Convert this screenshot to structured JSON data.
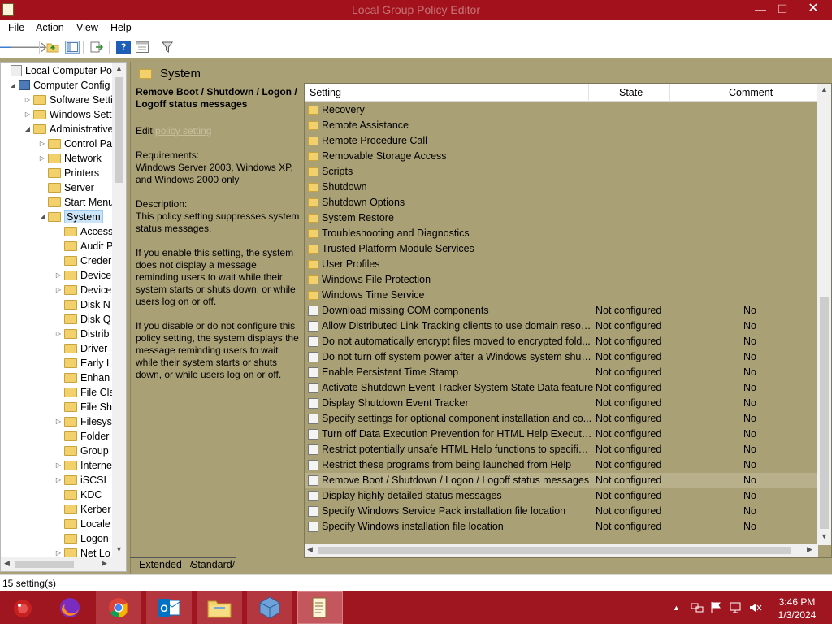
{
  "window": {
    "title": "Local Group Policy Editor",
    "controls": {
      "minimize": "—",
      "maximize": "☐",
      "close": "✕"
    }
  },
  "menu": [
    "File",
    "Action",
    "View",
    "Help"
  ],
  "toolbar": {
    "icons": [
      "back-icon",
      "forward-icon",
      "up-folder-icon",
      "show-hide-tree-icon",
      "export-list-icon",
      "help-icon",
      "view-icon",
      "filter-icon"
    ]
  },
  "tree": {
    "items": [
      {
        "label": "Local Computer Polic",
        "icon": "policy"
      },
      {
        "label": "Computer Config",
        "icon": "computer",
        "expander": "◢"
      },
      {
        "label": "Software Setti",
        "icon": "folder",
        "expander": "▷"
      },
      {
        "label": "Windows Sett",
        "icon": "folder",
        "expander": "▷"
      },
      {
        "label": "Administrative",
        "icon": "folder",
        "expander": "◢"
      },
      {
        "label": "Control Pa",
        "icon": "folder",
        "expander": "▷"
      },
      {
        "label": "Network",
        "icon": "folder",
        "expander": "▷"
      },
      {
        "label": "Printers",
        "icon": "folder",
        "expander": ""
      },
      {
        "label": "Server",
        "icon": "folder",
        "expander": ""
      },
      {
        "label": "Start Menu",
        "icon": "folder",
        "expander": ""
      },
      {
        "label": "System",
        "icon": "folder",
        "expander": "◢",
        "selected": true
      },
      {
        "label": "Access",
        "icon": "folder",
        "expander": ""
      },
      {
        "label": "Audit P",
        "icon": "folder",
        "expander": ""
      },
      {
        "label": "Creder",
        "icon": "folder",
        "expander": ""
      },
      {
        "label": "Device",
        "icon": "folder",
        "expander": "▷"
      },
      {
        "label": "Device",
        "icon": "folder",
        "expander": "▷"
      },
      {
        "label": "Disk N",
        "icon": "folder",
        "expander": ""
      },
      {
        "label": "Disk Q",
        "icon": "folder",
        "expander": ""
      },
      {
        "label": "Distrib",
        "icon": "folder",
        "expander": "▷"
      },
      {
        "label": "Driver",
        "icon": "folder",
        "expander": ""
      },
      {
        "label": "Early L",
        "icon": "folder",
        "expander": ""
      },
      {
        "label": "Enhan",
        "icon": "folder",
        "expander": ""
      },
      {
        "label": "File Cla",
        "icon": "folder",
        "expander": ""
      },
      {
        "label": "File Sh",
        "icon": "folder",
        "expander": ""
      },
      {
        "label": "Filesys",
        "icon": "folder",
        "expander": "▷"
      },
      {
        "label": "Folder",
        "icon": "folder",
        "expander": ""
      },
      {
        "label": "Group",
        "icon": "folder",
        "expander": ""
      },
      {
        "label": "Interne",
        "icon": "folder",
        "expander": "▷"
      },
      {
        "label": "iSCSI",
        "icon": "folder",
        "expander": "▷"
      },
      {
        "label": "KDC",
        "icon": "folder",
        "expander": ""
      },
      {
        "label": "Kerber",
        "icon": "folder",
        "expander": ""
      },
      {
        "label": "Locale",
        "icon": "folder",
        "expander": ""
      },
      {
        "label": "Logon",
        "icon": "folder",
        "expander": ""
      },
      {
        "label": "Net Lo",
        "icon": "folder",
        "expander": "▷"
      }
    ]
  },
  "header": {
    "title": "System"
  },
  "description": {
    "policy_title": "Remove Boot / Shutdown / Logon / Logoff status messages",
    "edit_prefix": "Edit",
    "edit_link": "policy setting",
    "requirements_label": "Requirements:",
    "requirements": "Windows Server 2003, Windows XP, and Windows 2000 only",
    "description_label": "Description:",
    "description": "This policy setting suppresses system status messages.",
    "enable_text": "If you enable this setting, the system does not display a message reminding users to wait while their system starts or shuts down, or while users log on or off.",
    "disable_text": "If you disable or do not configure this policy setting, the system displays the message reminding users to wait while their system starts or shuts down, or while users log on or off."
  },
  "list": {
    "columns": {
      "setting": "Setting",
      "state": "State",
      "comment": "Comment"
    },
    "rows": [
      {
        "name": "Recovery",
        "type": "folder",
        "state": "",
        "comment": ""
      },
      {
        "name": "Remote Assistance",
        "type": "folder",
        "state": "",
        "comment": ""
      },
      {
        "name": "Remote Procedure Call",
        "type": "folder",
        "state": "",
        "comment": ""
      },
      {
        "name": "Removable Storage Access",
        "type": "folder",
        "state": "",
        "comment": ""
      },
      {
        "name": "Scripts",
        "type": "folder",
        "state": "",
        "comment": ""
      },
      {
        "name": "Shutdown",
        "type": "folder",
        "state": "",
        "comment": ""
      },
      {
        "name": "Shutdown Options",
        "type": "folder",
        "state": "",
        "comment": ""
      },
      {
        "name": "System Restore",
        "type": "folder",
        "state": "",
        "comment": ""
      },
      {
        "name": "Troubleshooting and Diagnostics",
        "type": "folder",
        "state": "",
        "comment": ""
      },
      {
        "name": "Trusted Platform Module Services",
        "type": "folder",
        "state": "",
        "comment": ""
      },
      {
        "name": "User Profiles",
        "type": "folder",
        "state": "",
        "comment": ""
      },
      {
        "name": "Windows File Protection",
        "type": "folder",
        "state": "",
        "comment": ""
      },
      {
        "name": "Windows Time Service",
        "type": "folder",
        "state": "",
        "comment": ""
      },
      {
        "name": "Download missing COM components",
        "type": "policy",
        "state": "Not configured",
        "comment": "No"
      },
      {
        "name": "Allow Distributed Link Tracking clients to use domain resour...",
        "type": "policy",
        "state": "Not configured",
        "comment": "No"
      },
      {
        "name": "Do not automatically encrypt files moved to encrypted fold...",
        "type": "policy",
        "state": "Not configured",
        "comment": "No"
      },
      {
        "name": "Do not turn off system power after a Windows system shutd...",
        "type": "policy",
        "state": "Not configured",
        "comment": "No"
      },
      {
        "name": "Enable Persistent Time Stamp",
        "type": "policy",
        "state": "Not configured",
        "comment": "No"
      },
      {
        "name": "Activate Shutdown Event Tracker System State Data feature",
        "type": "policy",
        "state": "Not configured",
        "comment": "No"
      },
      {
        "name": "Display Shutdown Event Tracker",
        "type": "policy",
        "state": "Not configured",
        "comment": "No"
      },
      {
        "name": "Specify settings for optional component installation and co...",
        "type": "policy",
        "state": "Not configured",
        "comment": "No"
      },
      {
        "name": "Turn off Data Execution Prevention for HTML Help Executible",
        "type": "policy",
        "state": "Not configured",
        "comment": "No"
      },
      {
        "name": "Restrict potentially unsafe HTML Help functions to specified...",
        "type": "policy",
        "state": "Not configured",
        "comment": "No"
      },
      {
        "name": "Restrict these programs from being launched from Help",
        "type": "policy",
        "state": "Not configured",
        "comment": "No"
      },
      {
        "name": "Remove Boot / Shutdown / Logon / Logoff status messages",
        "type": "policy",
        "state": "Not configured",
        "comment": "No",
        "selected": true
      },
      {
        "name": "Display highly detailed status messages",
        "type": "policy",
        "state": "Not configured",
        "comment": "No"
      },
      {
        "name": "Specify Windows Service Pack installation file location",
        "type": "policy",
        "state": "Not configured",
        "comment": "No"
      },
      {
        "name": "Specify Windows installation file location",
        "type": "policy",
        "state": "Not configured",
        "comment": "No"
      }
    ]
  },
  "tabs": [
    "Extended",
    "Standard"
  ],
  "status": "15 setting(s)",
  "taskbar": {
    "apps": [
      "app-icon",
      "firefox-icon",
      "chrome-icon",
      "outlook-icon",
      "file-explorer-icon",
      "virtualbox-icon",
      "group-policy-editor-icon"
    ],
    "tray_icons": [
      "show-hidden-icons",
      "network-icon",
      "action-center-flag-icon",
      "connection-icon",
      "volume-muted-icon"
    ],
    "time": "3:46 PM",
    "date": "1/3/2024"
  },
  "colors": {
    "accent": "#a3111c",
    "pane_bg": "#a9a076",
    "selection": "#b7b08a"
  }
}
